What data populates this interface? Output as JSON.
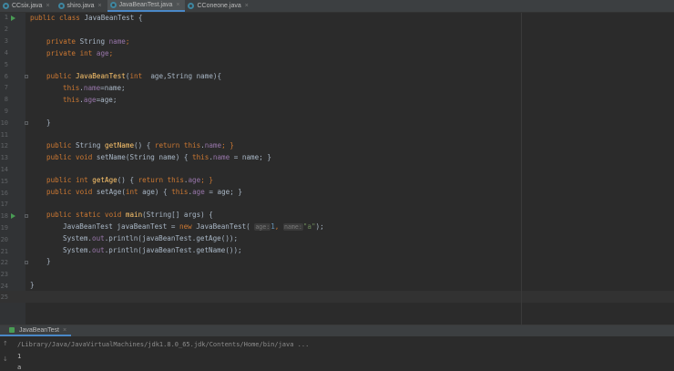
{
  "tabs": [
    {
      "label": "CCsix.java",
      "close": "×"
    },
    {
      "label": "shiro.java",
      "close": "×"
    },
    {
      "label": "JavaBeanTest.java",
      "close": "×"
    },
    {
      "label": "CConeone.java",
      "close": "×"
    }
  ],
  "line_numbers": [
    "1",
    "2",
    "3",
    "4",
    "5",
    "6",
    "7",
    "8",
    "9",
    "10",
    "11",
    "12",
    "13",
    "14",
    "15",
    "16",
    "17",
    "18",
    "19",
    "20",
    "21",
    "22",
    "23",
    "24",
    "25"
  ],
  "code": {
    "l1": {
      "kw": "public class",
      "name": " JavaBeanTest {"
    },
    "l3": {
      "kw": "private",
      "type": " String ",
      "field": "name",
      "end": ";"
    },
    "l4": {
      "kw": "private int",
      "field": " age",
      "end": ";"
    },
    "l6": {
      "kw": "public",
      "fn": " JavaBeanTest",
      "open": "(",
      "kw2": "int",
      "rest": "  age,String name){"
    },
    "l7": {
      "kw": "this",
      "dot": ".",
      "field": "name",
      "rest": "=name;"
    },
    "l8": {
      "kw": "this",
      "dot": ".",
      "field": "age",
      "rest": "=age;"
    },
    "l10": {
      "brace": "}"
    },
    "l12": {
      "kw": "public",
      "type": " String ",
      "fn": "getName",
      "mid": "() { ",
      "kw2": "return",
      "kw3": " this",
      "dot": ".",
      "field": "name",
      "end": "; }"
    },
    "l13": {
      "kw": "public void",
      "fn": " setName",
      "mid": "(String name) { ",
      "kw2": "this",
      "dot": ".",
      "field": "name",
      "end": " = name; }"
    },
    "l15": {
      "kw": "public int",
      "fn": " getAge",
      "mid": "() { ",
      "kw2": "return",
      "kw3": " this",
      "dot": ".",
      "field": "age",
      "end": "; }"
    },
    "l16": {
      "kw": "public void",
      "fn": " setAge",
      "mid": "(",
      "kw2": "int",
      "mid2": " age) { ",
      "kw3": "this",
      "dot": ".",
      "field": "age",
      "end": " = age; }"
    },
    "l18": {
      "kw": "public static void",
      "fn": " main",
      "rest": "(String[] args) {"
    },
    "l19": {
      "pre": "JavaBeanTest javaBeanTest = ",
      "kw": "new",
      "mid": " JavaBeanTest( ",
      "hint1": "age:",
      "num": "1",
      "comma": ", ",
      "hint2": "name:",
      "str": "\"a\"",
      "end": ");"
    },
    "l20": {
      "pre": "System.",
      "field": "out",
      "rest": ".println(javaBeanTest.getAge());"
    },
    "l21": {
      "pre": "System.",
      "field": "out",
      "rest": ".println(javaBeanTest.getName());"
    },
    "l22": {
      "brace": "}"
    },
    "l24": {
      "brace": "}"
    }
  },
  "run_panel": {
    "tab_label": "JavaBeanTest",
    "tab_close": "×",
    "command": "/Library/Java/JavaVirtualMachines/jdk1.8.0_65.jdk/Contents/Home/bin/java ...",
    "output": [
      "1",
      "a"
    ],
    "icons": [
      "rerun-up-icon",
      "rerun-down-icon"
    ]
  },
  "colors": {
    "keyword": "#cc7832",
    "function": "#ffc66d",
    "field": "#9876aa",
    "string": "#6a8759",
    "number": "#6897bb",
    "text": "#a9b7c6",
    "background": "#2b2b2b",
    "run_arrow": "#499c54"
  }
}
